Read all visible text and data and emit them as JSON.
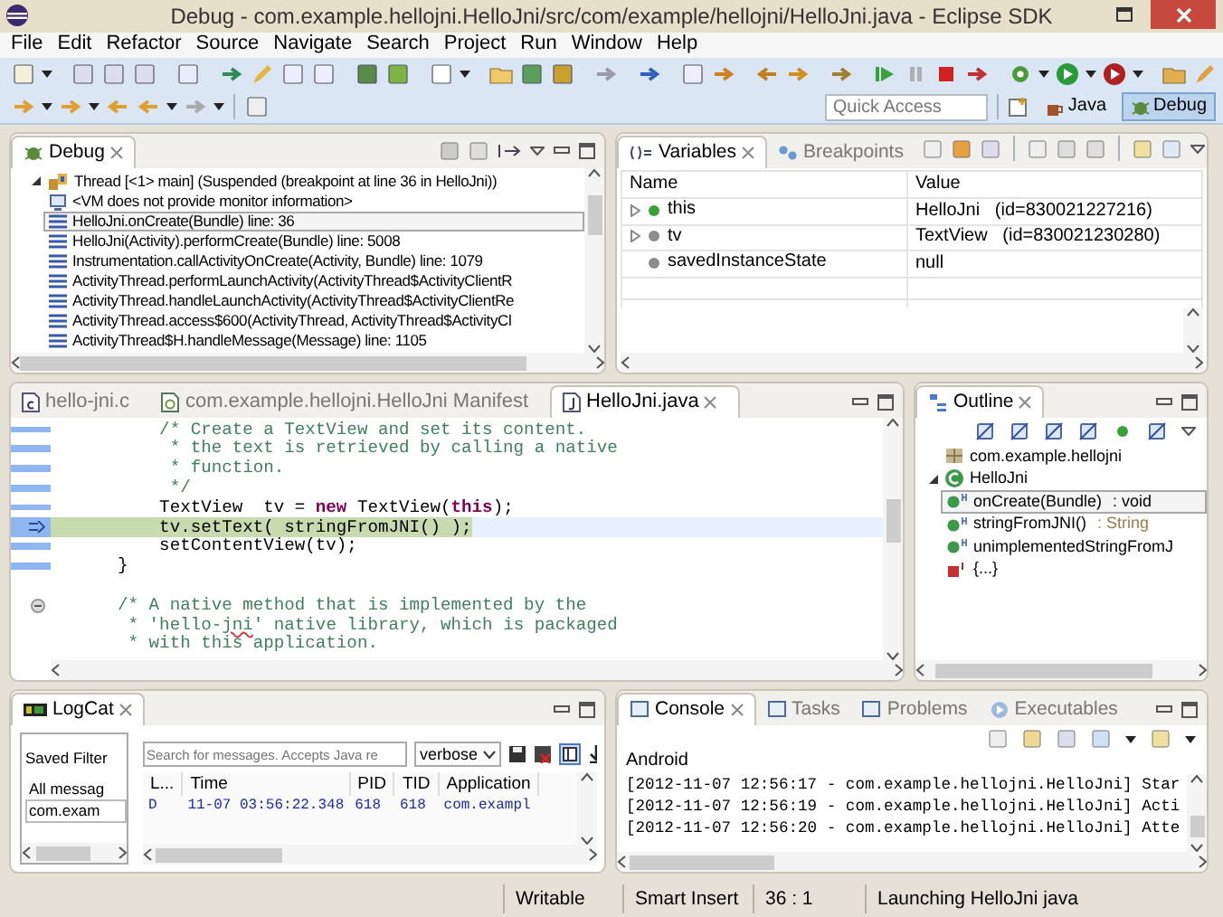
{
  "window": {
    "title": "Debug - com.example.hellojni.HelloJni/src/com/example/hellojni/HelloJni.java - Eclipse SDK"
  },
  "menu": [
    "File",
    "Edit",
    "Refactor",
    "Source",
    "Navigate",
    "Search",
    "Project",
    "Run",
    "Window",
    "Help"
  ],
  "quick_access": {
    "placeholder": "Quick Access"
  },
  "perspectives": [
    {
      "label": "Java",
      "selected": false
    },
    {
      "label": "Debug",
      "selected": true
    }
  ],
  "debug_view": {
    "tabs": [
      {
        "label": "Debug",
        "selected": true
      }
    ],
    "thread": {
      "label": "Thread [<1> main] (Suspended (breakpoint at line 36 in HelloJni))",
      "expanded": true,
      "children": [
        {
          "label": "<VM does not provide monitor information>",
          "kind": "monitor",
          "selected": false
        },
        {
          "label": "HelloJni.onCreate(Bundle) line: 36",
          "kind": "frame",
          "selected": true
        },
        {
          "label": "HelloJni(Activity).performCreate(Bundle) line: 5008",
          "kind": "frame",
          "selected": false
        },
        {
          "label": "Instrumentation.callActivityOnCreate(Activity, Bundle) line: 1079",
          "kind": "frame",
          "selected": false
        },
        {
          "label": "ActivityThread.performLaunchActivity(ActivityThread$ActivityClientR",
          "kind": "frame",
          "selected": false
        },
        {
          "label": "ActivityThread.handleLaunchActivity(ActivityThread$ActivityClientRe",
          "kind": "frame",
          "selected": false
        },
        {
          "label": "ActivityThread.access$600(ActivityThread, ActivityThread$ActivityCl",
          "kind": "frame",
          "selected": false
        },
        {
          "label": "ActivityThread$H.handleMessage(Message) line: 1105",
          "kind": "frame",
          "selected": false
        }
      ]
    }
  },
  "variables_view": {
    "tabs": [
      {
        "label": "Variables",
        "selected": true
      },
      {
        "label": "Breakpoints",
        "selected": false
      }
    ],
    "columns": [
      "Name",
      "Value"
    ],
    "rows": [
      {
        "name": "this",
        "value": "HelloJni   (id=830021227216)",
        "expandable": true,
        "color": "#3aa03a"
      },
      {
        "name": "tv",
        "value": "TextView   (id=830021230280)",
        "expandable": true,
        "color": "#8c8c8c"
      },
      {
        "name": "savedInstanceState",
        "value": "null",
        "expandable": false,
        "color": "#8c8c8c"
      }
    ]
  },
  "editor": {
    "tabs": [
      {
        "label": "hello-jni.c",
        "kind": "c",
        "selected": false
      },
      {
        "label": "com.example.hellojni.HelloJni Manifest",
        "kind": "manifest",
        "selected": false
      },
      {
        "label": "HelloJni.java",
        "kind": "java",
        "selected": true
      }
    ],
    "lines": [
      {
        "kind": "code",
        "current": false,
        "fold": false,
        "segments": [
          {
            "kind": "comment",
            "text": "        /* Create a TextView and set its content."
          }
        ]
      },
      {
        "kind": "code",
        "current": false,
        "fold": false,
        "segments": [
          {
            "kind": "comment",
            "text": "         * the text is retrieved by calling a native"
          }
        ]
      },
      {
        "kind": "code",
        "current": false,
        "fold": false,
        "segments": [
          {
            "kind": "comment",
            "text": "         * function."
          }
        ]
      },
      {
        "kind": "code",
        "current": false,
        "fold": false,
        "segments": [
          {
            "kind": "comment",
            "text": "         */"
          }
        ]
      },
      {
        "kind": "code",
        "current": false,
        "fold": false,
        "segments": [
          {
            "kind": "plain",
            "text": "        TextView  tv = "
          },
          {
            "kind": "keyword",
            "text": "new"
          },
          {
            "kind": "plain",
            "text": " TextView("
          },
          {
            "kind": "keyword",
            "text": "this"
          },
          {
            "kind": "plain",
            "text": ");"
          }
        ]
      },
      {
        "kind": "code",
        "current": true,
        "fold": false,
        "segments": [
          {
            "kind": "plain",
            "text": "        tv.setText( stringFromJNI() );"
          }
        ]
      },
      {
        "kind": "code",
        "current": false,
        "fold": false,
        "segments": [
          {
            "kind": "plain",
            "text": "        setContentView(tv);"
          }
        ]
      },
      {
        "kind": "code",
        "current": false,
        "fold": false,
        "segments": [
          {
            "kind": "plain",
            "text": "    }"
          }
        ]
      },
      {
        "kind": "blank",
        "current": false,
        "fold": false
      },
      {
        "kind": "code",
        "current": false,
        "fold": true,
        "segments": [
          {
            "kind": "comment",
            "text": "    /* A native method that is implemented by the"
          }
        ]
      },
      {
        "kind": "code",
        "current": false,
        "fold": false,
        "segments": [
          {
            "kind": "comment",
            "text": "     * 'hello-"
          },
          {
            "kind": "misspelled",
            "text": "jni"
          },
          {
            "kind": "comment",
            "text": "' native library, which is packaged"
          }
        ]
      },
      {
        "kind": "code",
        "current": false,
        "fold": false,
        "segments": [
          {
            "kind": "comment",
            "text": "     * with this application."
          }
        ]
      }
    ]
  },
  "outline": {
    "tabs": [
      {
        "label": "Outline",
        "selected": true
      }
    ],
    "items": [
      {
        "label": "com.example.hellojni",
        "kind": "package",
        "selected": false
      },
      {
        "label": "HelloJni",
        "kind": "class",
        "selected": false,
        "expanded": true,
        "children": [
          {
            "label": "onCreate(Bundle)",
            "return_type": ": void",
            "kind": "method",
            "selected": true
          },
          {
            "label": "stringFromJNI()",
            "return_type": ": String",
            "kind": "method",
            "selected": false
          },
          {
            "label": "unimplementedStringFromJ",
            "kind": "method",
            "selected": false
          },
          {
            "label": "{...}",
            "kind": "initializer",
            "selected": false
          }
        ]
      }
    ]
  },
  "logcat": {
    "tabs": [
      {
        "label": "LogCat",
        "selected": true
      }
    ],
    "saved_filters": {
      "title": "Saved Filter",
      "items": [
        {
          "label": "All messag",
          "selected": false
        },
        {
          "label": "com.exam",
          "selected": true
        }
      ]
    },
    "search": {
      "placeholder": "Search for messages. Accepts Java re"
    },
    "level": "verbose",
    "columns": [
      "L...",
      "Time",
      "PID",
      "TID",
      "Application"
    ],
    "rows": [
      [
        "D",
        "11-07 03:56:22.348",
        "618",
        "618",
        "com.exampl"
      ]
    ]
  },
  "console": {
    "tabs": [
      {
        "label": "Console",
        "selected": true
      },
      {
        "label": "Tasks",
        "selected": false
      },
      {
        "label": "Problems",
        "selected": false
      },
      {
        "label": "Executables",
        "selected": false
      }
    ],
    "label": "Android",
    "lines": [
      "[2012-11-07 12:56:17 - com.example.hellojni.HelloJni] Star",
      "[2012-11-07 12:56:19 - com.example.hellojni.HelloJni] Acti",
      "[2012-11-07 12:56:20 - com.example.hellojni.HelloJni] Atte"
    ]
  },
  "status_bar": [
    "Writable",
    "Smart Insert",
    "36 : 1",
    "Launching HelloJni java"
  ]
}
